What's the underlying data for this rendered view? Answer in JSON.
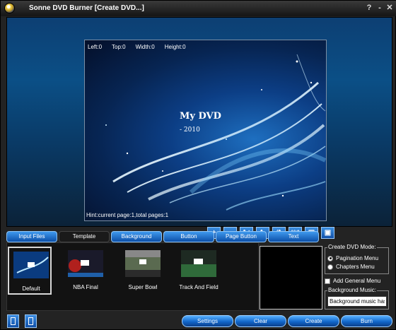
{
  "window": {
    "title": "Sonne DVD Burner [Create DVD...]",
    "help_label": "?",
    "minimize_label": "-",
    "close_label": "✕"
  },
  "preview": {
    "left_label": "Left:0",
    "top_label": "Top:0",
    "width_label": "Width:0",
    "height_label": "Height:0",
    "menu_title": "My DVD",
    "menu_subtitle": "- 2010",
    "hint": "Hint:current page:1,total pages:1"
  },
  "toolbar": {
    "buttons": [
      {
        "icon": "plus-icon",
        "label": "+"
      },
      {
        "icon": "minus-icon",
        "label": "−"
      },
      {
        "icon": "font-increase-icon",
        "label": "A+"
      },
      {
        "icon": "font-decrease-icon",
        "label": "A-"
      },
      {
        "icon": "text-style-icon",
        "label": "⁄A"
      },
      {
        "icon": "aspect-ratio-icon",
        "label": "16:9"
      },
      {
        "icon": "zoom-in-icon",
        "label": "▣"
      },
      {
        "icon": "zoom-out-icon",
        "label": "▣"
      }
    ]
  },
  "tabs": [
    {
      "label": "Input Files",
      "active": false
    },
    {
      "label": "Template",
      "active": true
    },
    {
      "label": "Background",
      "active": false
    },
    {
      "label": "Button",
      "active": false
    },
    {
      "label": "Page Button",
      "active": false
    },
    {
      "label": "Text",
      "active": false
    }
  ],
  "templates": [
    {
      "label": "Default",
      "selected": true
    },
    {
      "label": "NBA Final",
      "selected": false
    },
    {
      "label": "Super Bowl",
      "selected": false
    },
    {
      "label": "Track And Field",
      "selected": false
    }
  ],
  "options": {
    "create_mode_label": "Create DVD Mode:",
    "pagination_label": "Pagination Menu",
    "chapters_label": "Chapters Menu",
    "mode_selected": "Pagination Menu",
    "add_general_menu_label": "Add General Menu",
    "add_general_menu_checked": false,
    "background_music_label": "Background Music:",
    "background_music_value": "Background music has no"
  },
  "actions": {
    "settings_label": "Settings",
    "clear_label": "Clear",
    "create_label": "Create",
    "burn_label": "Burn"
  },
  "colors": {
    "accent_blue": "#1266c9",
    "window_bg": "#232323"
  }
}
